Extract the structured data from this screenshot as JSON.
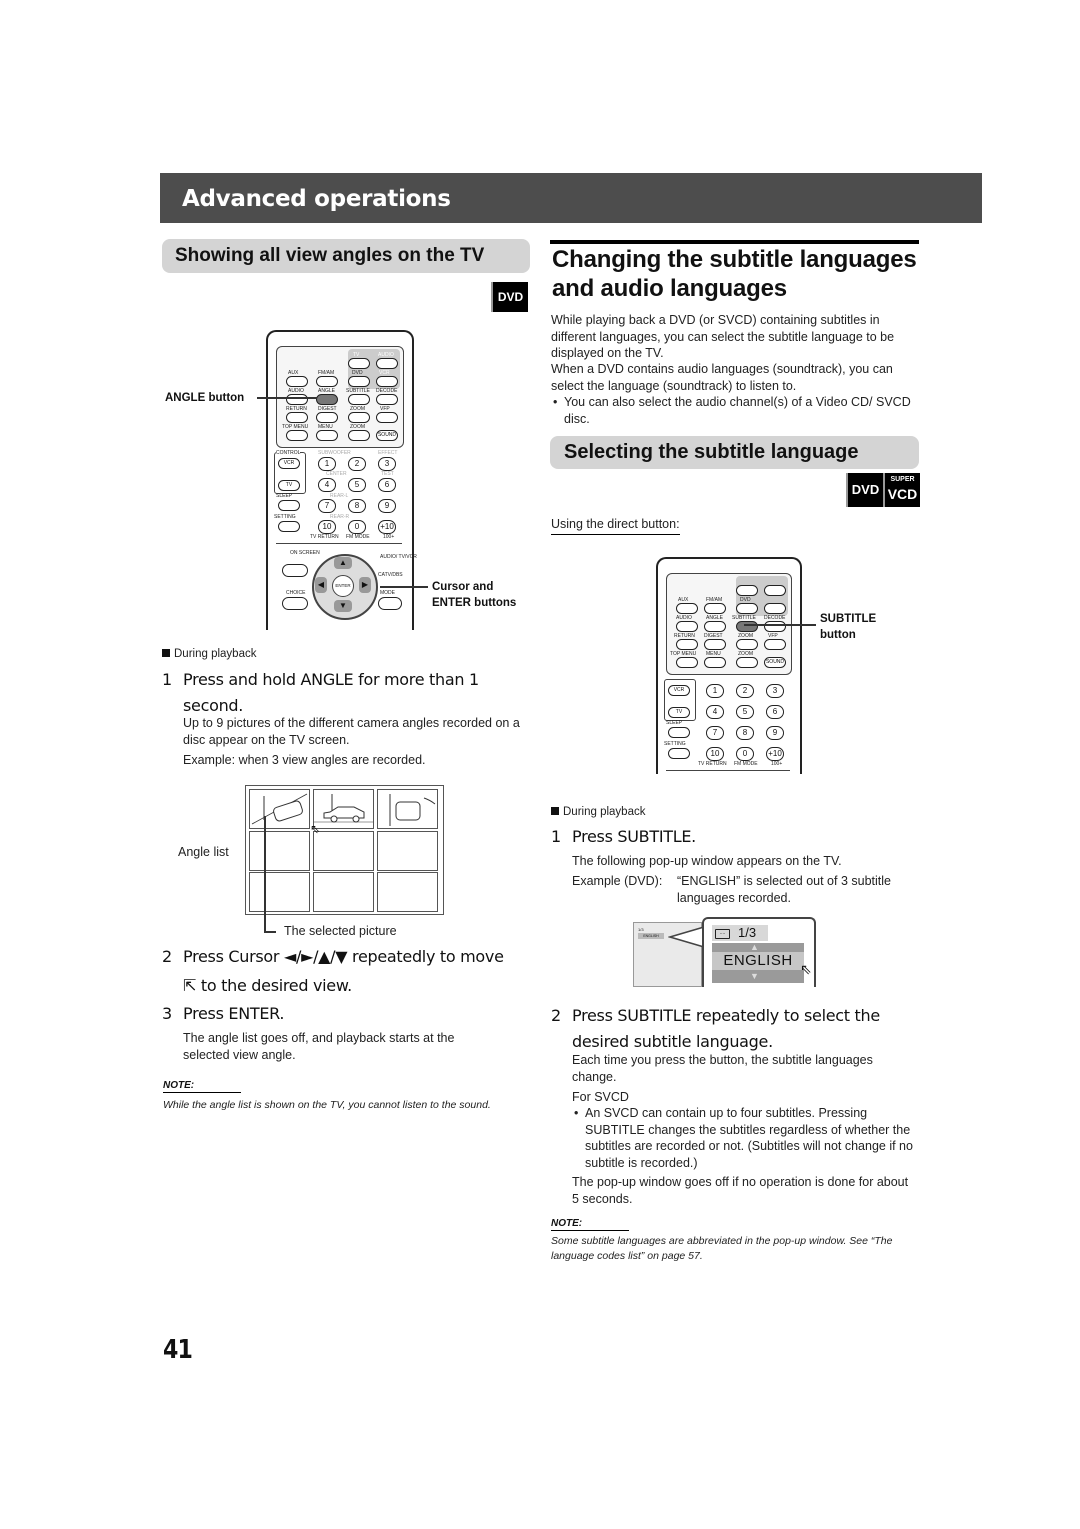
{
  "header": {
    "title": "Advanced operations"
  },
  "left": {
    "section_title": "Showing all view angles on the TV",
    "badge": "DVD",
    "remote": {
      "callout_angle": "ANGLE button",
      "callout_cursor_1": "Cursor and",
      "callout_cursor_2": "ENTER buttons",
      "top_labels": {
        "tv": "TV",
        "audio": "AUDIO",
        "vcr": "VCR",
        "aux": "AUX",
        "fmam": "FM/AM",
        "dvd": "DVD"
      },
      "row_labels": [
        "AUDIO",
        "ANGLE",
        "SUBTITLE",
        "DECODE",
        "RETURN",
        "DIGEST",
        "ZOOM",
        "VFP",
        "TOP MENU",
        "MENU",
        "ZOOM",
        "SOUND"
      ],
      "numpad": {
        "control": "CONTROL",
        "vcr": "VCR",
        "tv": "TV",
        "sleep": "SLEEP",
        "setting": "SETTING",
        "subwoofer": "SUBWOOFER",
        "center": "CENTER",
        "rear_l": "REAR-L",
        "rear_r": "REAR-R",
        "effect": "EFFECT",
        "test": "TEST",
        "keys": [
          "1",
          "2",
          "3",
          "4",
          "5",
          "6",
          "7",
          "8",
          "9",
          "10",
          "0",
          "+10"
        ],
        "tv_return": "TV RETURN",
        "fm_mode": "FM MODE",
        "hundred": "100+"
      },
      "cursor": {
        "on_screen": "ON SCREEN",
        "choice": "CHOICE",
        "enter": "ENTER",
        "audio_tv": "AUDIO/ TV/VCR",
        "catv": "CATV/DBS",
        "mode": "MODE"
      }
    },
    "during": "During playback",
    "step1": {
      "num": "1",
      "text": "Press and hold ANGLE for more than 1 second."
    },
    "step1_body": "Up to 9 pictures of the different camera angles recorded on a disc appear on the TV screen.",
    "step1_example": "Example: when 3 view angles are recorded.",
    "angle_list_label": "Angle list",
    "selected_picture_label": "The selected picture",
    "step2": {
      "num": "2",
      "text_a": "Press Cursor ◄/►/▲/▼ repeatedly to move",
      "text_b": "to the desired view."
    },
    "step3": {
      "num": "3",
      "text": "Press ENTER."
    },
    "step3_body": "The angle list goes off, and playback starts at the selected view angle.",
    "note_label": "NOTE:",
    "note_text": "While the angle list is shown on the TV, you cannot listen to the sound."
  },
  "right": {
    "title": "Changing the subtitle languages and audio languages",
    "intro_1": "While playing back a DVD (or SVCD) containing subtitles in different languages, you can select the subtitle language to be displayed on the TV.",
    "intro_2": "When a DVD contains audio languages (soundtrack), you can select the language (soundtrack) to listen to.",
    "intro_bullet": "You can also select the audio channel(s) of a Video CD/ SVCD disc.",
    "section_title": "Selecting the subtitle language",
    "badges": {
      "dvd": "DVD",
      "super": "SUPER",
      "vcd": "VCD"
    },
    "using_direct": "Using the direct button:",
    "callout_subtitle_1": "SUBTITLE",
    "callout_subtitle_2": "button",
    "during": "During playback",
    "step1": {
      "num": "1",
      "text": "Press SUBTITLE."
    },
    "step1_body": "The following pop-up window appears on the TV.",
    "example_label": "Example (DVD):",
    "example_text": "“ENGLISH” is selected out of 3 subtitle languages recorded.",
    "popup": {
      "counter": "1/3",
      "language": "ENGLISH"
    },
    "step2": {
      "num": "2",
      "text": "Press SUBTITLE repeatedly to select the desired subtitle language."
    },
    "step2_body": "Each time you press the button, the subtitle languages change.",
    "for_svcd": "For SVCD",
    "svcd_bullet": "An SVCD can contain up to four subtitles. Pressing SUBTITLE changes the subtitles regardless of whether the subtitles are recorded or not. (Subtitles will not change if no subtitle is recorded.)",
    "popup_off": "The pop-up window goes off if no operation is done for about 5 seconds.",
    "note_label": "NOTE:",
    "note_text": "Some subtitle languages are abbreviated in the pop-up window. See “The language codes list” on page 57."
  },
  "page_number": "41"
}
